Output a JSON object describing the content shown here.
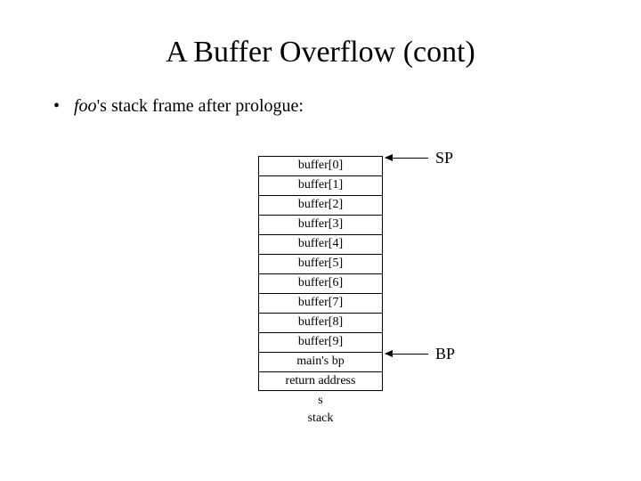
{
  "title": "A Buffer Overflow (cont)",
  "bullet": {
    "foo": "foo",
    "rest": "'s stack frame after prologue:"
  },
  "stack": {
    "cells": [
      "buffer[0]",
      "buffer[1]",
      "buffer[2]",
      "buffer[3]",
      "buffer[4]",
      "buffer[5]",
      "buffer[6]",
      "buffer[7]",
      "buffer[8]",
      "buffer[9]",
      "main's bp",
      "return address"
    ],
    "below1": "s",
    "below2": "stack"
  },
  "pointers": {
    "sp": "SP",
    "bp": "BP"
  }
}
